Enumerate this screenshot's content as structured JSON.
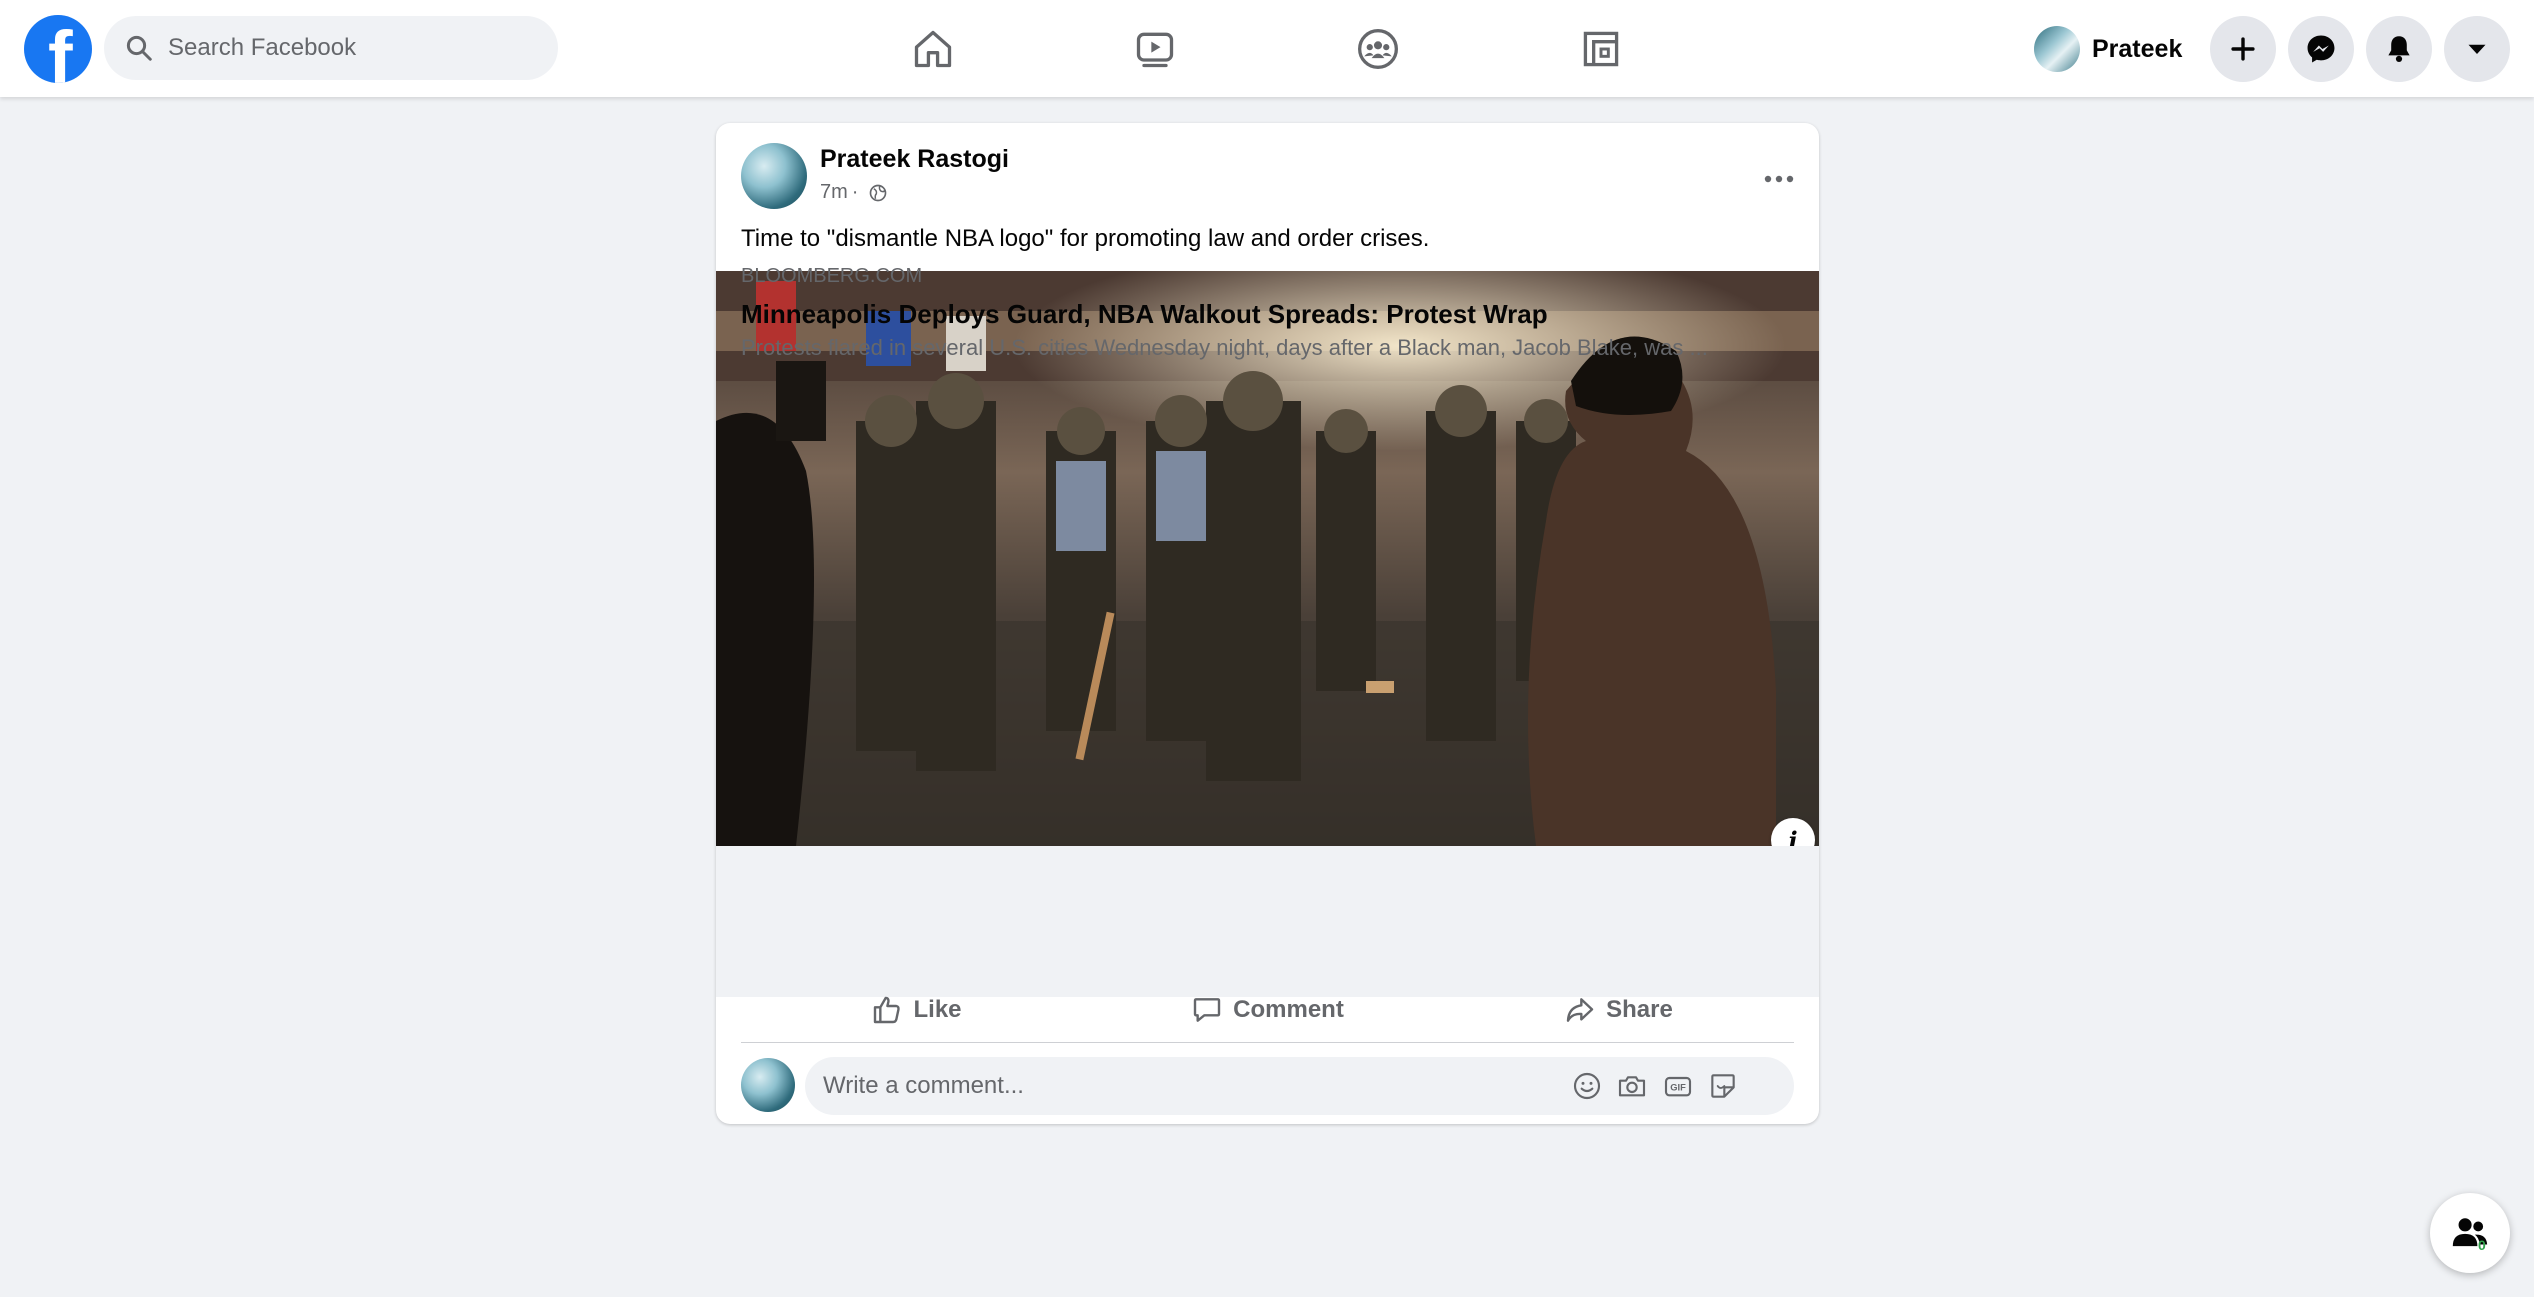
{
  "nav": {
    "search_placeholder": "Search Facebook",
    "profile_name": "Prateek",
    "tabs": [
      "home-icon",
      "watch-icon",
      "groups-icon",
      "gaming-icon"
    ],
    "brand_color": "#1877f2"
  },
  "post": {
    "author": "Prateek Rastogi",
    "time": "7m",
    "separator": "·",
    "text": "Time to \"dismantle NBA logo\" for promoting law and order crises.",
    "link": {
      "domain": "BLOOMBERG.COM",
      "title": "Minneapolis Deploys Guard, NBA Walkout Spreads: Protest Wrap",
      "description": "Protests flared in several U.S. cities Wednesday night, days after a Black man, Jacob Blake, was ..."
    },
    "actions": {
      "like": "Like",
      "comment": "Comment",
      "share": "Share"
    },
    "comment_placeholder": "Write a comment..."
  },
  "contacts": {
    "online_count": "0"
  }
}
